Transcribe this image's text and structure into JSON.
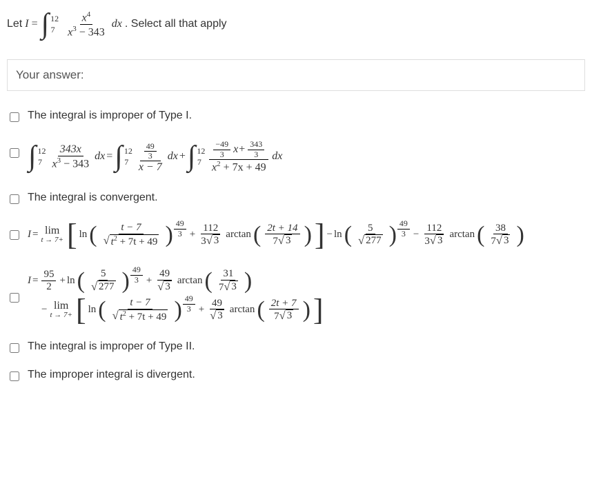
{
  "question": {
    "prefix": "Let ",
    "var": "I",
    "eq": " = ",
    "int_up": "12",
    "int_lo": "7",
    "num": "x",
    "num_exp": "4",
    "den_a": "x",
    "den_exp": "3",
    "den_rest": " − 343",
    "dx": "dx",
    "suffix": ". Select all that apply"
  },
  "answer_label": "Your answer:",
  "opts": {
    "o1": "The integral is improper of Type I.",
    "o3": "The integral is convergent.",
    "o6": "The integral is improper of Type II.",
    "o7": "The improper integral is divergent."
  },
  "eq2": {
    "i1_up": "12",
    "i1_lo": "7",
    "f1_num": "343x",
    "f1_den": "x",
    "f1_dexp": "3",
    "f1_drest": " − 343",
    "dx": "dx",
    "eq": " = ",
    "i2_up": "12",
    "i2_lo": "7",
    "f2_num_num": "49",
    "f2_num_den": "3",
    "f2_den": "x − 7",
    "plus": " + ",
    "i3_up": "12",
    "i3_lo": "7",
    "f3_num_t1n": "−49",
    "f3_num_t1d": "3",
    "f3_num_var": "x",
    "f3_num_plus": " + ",
    "f3_num_t2n": "343",
    "f3_num_t2d": "3",
    "f3_den": "x",
    "f3_dexp": "2",
    "f3_drest": " + 7x + 49"
  },
  "eq4": {
    "lhs": "I",
    "eq": " = ",
    "lim": "lim",
    "lim_sub": "t → 7+",
    "ln": "ln",
    "a_num": "t − 7",
    "a_den_rad": "t",
    "a_den_rexp": "2",
    "a_den_rest": " + 7t + 49",
    "exp_n": "49",
    "exp_d": "3",
    "plus": " + ",
    "b_num": "112",
    "b_den_c": "3",
    "b_den_r": "3",
    "arctan": "arctan",
    "b_arg_num": "2t + 14",
    "b_arg_den_c": "7",
    "b_arg_den_r": "3",
    "minus": " − ",
    "c_num": "5",
    "c_den_r": "277",
    "d_num": "112",
    "d_den_c": "3",
    "d_den_r": "3",
    "d_arg_num": "38",
    "d_arg_den_c": "7",
    "d_arg_den_r": "3"
  },
  "eq5a": {
    "lhs": "I",
    "eq": " = ",
    "a_num": "95",
    "a_den": "2",
    "plus": " + ",
    "ln": "ln",
    "b_num": "5",
    "b_den_r": "277",
    "exp_n": "49",
    "exp_d": "3",
    "c_num": "49",
    "c_den_r": "3",
    "arctan": "arctan",
    "c_arg_num": "31",
    "c_arg_den_c": "7",
    "c_arg_den_r": "3"
  },
  "eq5b": {
    "minus": " − ",
    "lim": "lim",
    "lim_sub": "t → 7+",
    "ln": "ln",
    "a_num": "t − 7",
    "a_den_rad": "t",
    "a_den_rexp": "2",
    "a_den_rest": " + 7t + 49",
    "exp_n": "49",
    "exp_d": "3",
    "plus": " + ",
    "b_num": "49",
    "b_den_r": "3",
    "arctan": "arctan",
    "b_arg_num": "2t + 7",
    "b_arg_den_c": "7",
    "b_arg_den_r": "3"
  }
}
